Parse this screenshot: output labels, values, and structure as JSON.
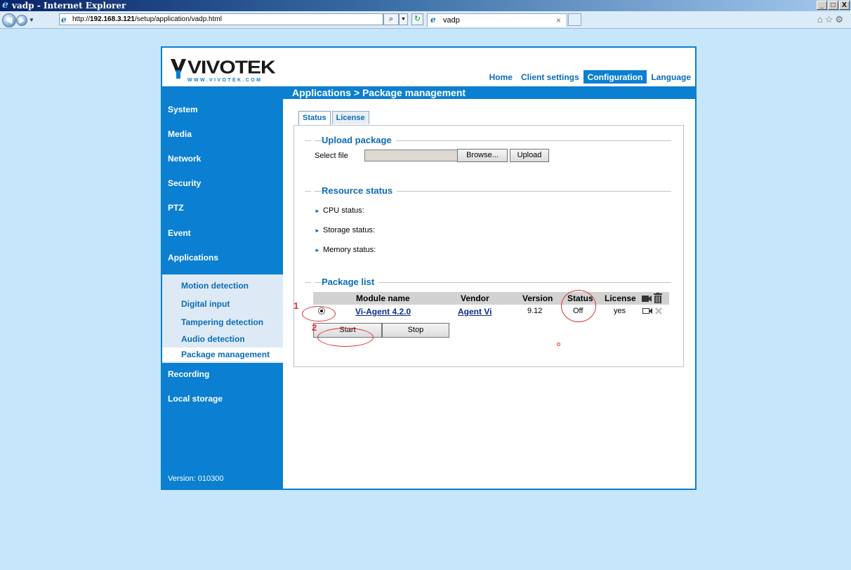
{
  "window": {
    "title": "vadp - Internet Explorer",
    "controls": [
      "_",
      "□",
      "X"
    ]
  },
  "browser": {
    "url_prefix": "http://",
    "url_host": "192.168.3.121",
    "url_path": "/setup/application/vadp.html",
    "tab_title": "vadp"
  },
  "brand": {
    "name": "VIVOTEK",
    "url": "WWW.VIVOTEK.COM",
    "color": "#0b7fd1"
  },
  "topnav": {
    "home": "Home",
    "client": "Client settings",
    "config": "Configuration",
    "language": "Language"
  },
  "breadcrumb": "Applications  > Package management",
  "sidebar": {
    "items": [
      "System",
      "Media",
      "Network",
      "Security",
      "PTZ",
      "Event",
      "Applications"
    ],
    "sub": [
      "Motion detection",
      "Digital input",
      "Tampering detection",
      "Audio detection",
      "Package management"
    ],
    "after": [
      "Recording",
      "Local storage"
    ],
    "version": "Version: 010300"
  },
  "tabs": {
    "status": "Status",
    "license": "License"
  },
  "upload": {
    "title": "Upload package",
    "select_label": "Select file",
    "browse": "Browse...",
    "upload": "Upload"
  },
  "resource": {
    "title": "Resource status",
    "cpu": "CPU status:",
    "storage": "Storage status:",
    "memory": "Memory status:"
  },
  "package": {
    "title": "Package list",
    "headers": {
      "module": "Module name",
      "vendor": "Vendor",
      "version": "Version",
      "status": "Status",
      "license": "License"
    },
    "row": {
      "module": "Vi-Agent 4.2.0",
      "vendor": "Agent Vi",
      "version": "9.12",
      "status": "Off",
      "license": "yes"
    },
    "start": "Start",
    "stop": "Stop"
  },
  "annotations": {
    "one": "1",
    "two": "2"
  }
}
